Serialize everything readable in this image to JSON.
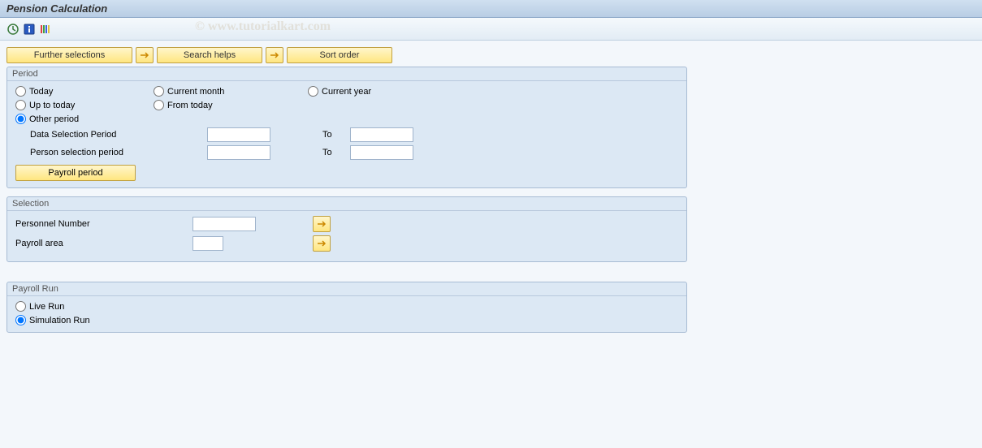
{
  "title": "Pension Calculation",
  "watermark": "© www.tutorialkart.com",
  "toolbar_buttons": {
    "further_selections": "Further selections",
    "search_helps": "Search helps",
    "sort_order": "Sort order"
  },
  "period_panel": {
    "title": "Period",
    "radios": {
      "today": "Today",
      "current_month": "Current month",
      "current_year": "Current year",
      "up_to_today": "Up to today",
      "from_today": "From today",
      "other_period": "Other period"
    },
    "data_selection_label": "Data Selection Period",
    "person_selection_label": "Person selection period",
    "to_label": "To",
    "data_from": "",
    "data_to": "",
    "person_from": "",
    "person_to": "",
    "payroll_period_btn": "Payroll period"
  },
  "selection_panel": {
    "title": "Selection",
    "personnel_number_label": "Personnel Number",
    "payroll_area_label": "Payroll area",
    "personnel_number": "",
    "payroll_area": ""
  },
  "payroll_run_panel": {
    "title": "Payroll Run",
    "live_run": "Live Run",
    "simulation_run": "Simulation Run"
  }
}
